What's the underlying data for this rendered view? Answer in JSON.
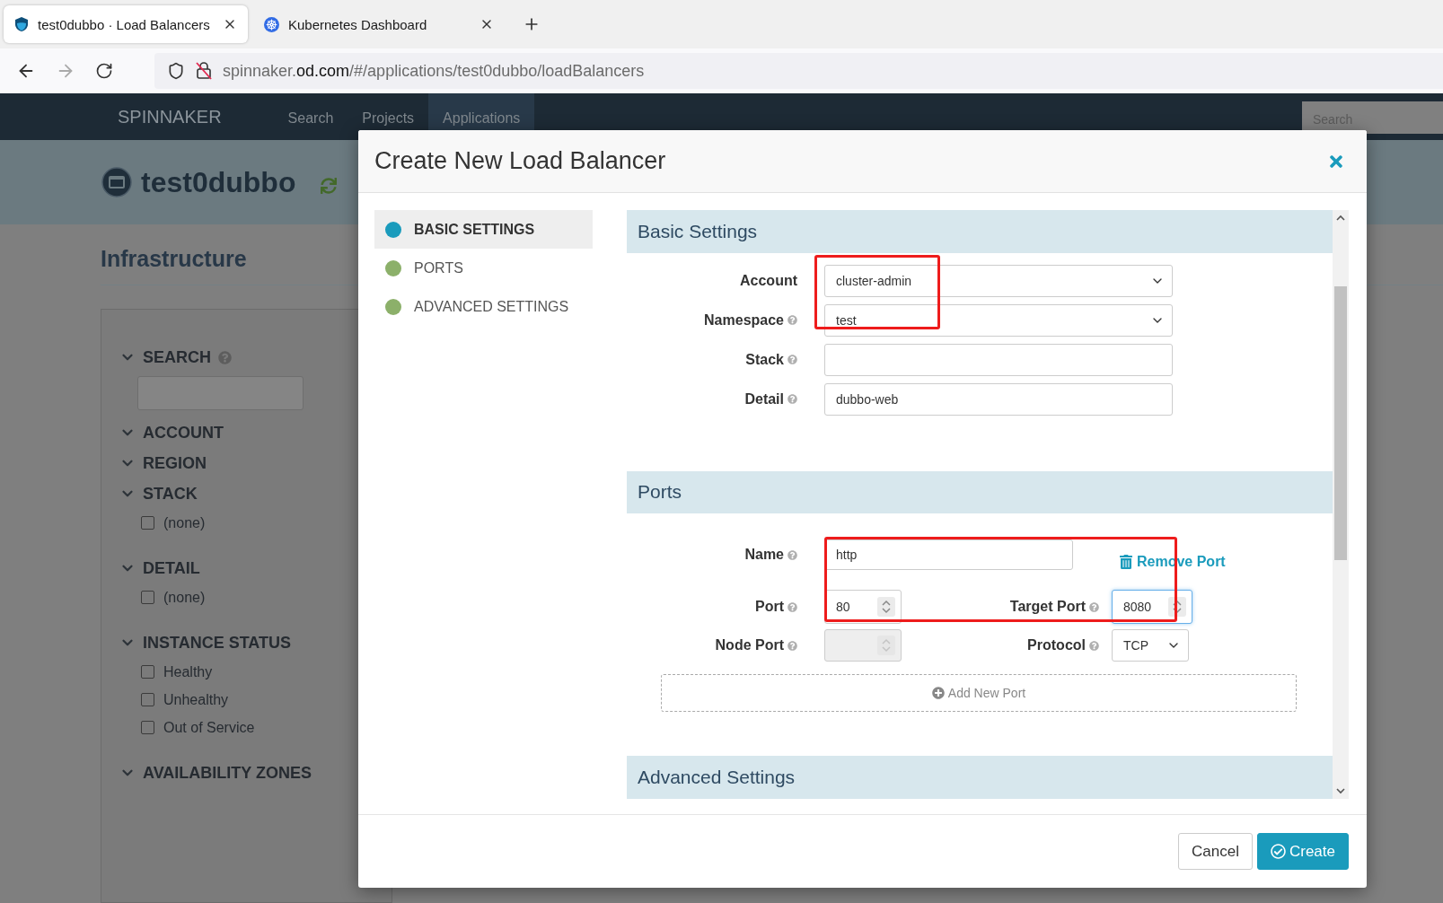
{
  "browser": {
    "tabs": [
      {
        "title": "test0dubbo · Load Balancers",
        "selected": true
      },
      {
        "title": "Kubernetes Dashboard",
        "selected": false
      }
    ],
    "url": {
      "prefix": "spinnaker.",
      "domain": "od.com",
      "path": "/#/applications/test0dubbo/loadBalancers"
    }
  },
  "navbar": {
    "brand": "SPINNAKER",
    "items": [
      {
        "label": "Search",
        "selected": false
      },
      {
        "label": "Projects",
        "selected": false
      },
      {
        "label": "Applications",
        "selected": true
      }
    ],
    "search": {
      "placeholder": "Search"
    }
  },
  "application": {
    "name": "test0dubbo",
    "section": "Infrastructure",
    "filters": [
      {
        "kind": "search",
        "label": "SEARCH",
        "help": true,
        "expanded": true
      },
      {
        "kind": "group",
        "label": "ACCOUNT",
        "help": false,
        "expanded": true
      },
      {
        "kind": "group",
        "label": "REGION",
        "help": false,
        "expanded": true
      },
      {
        "kind": "group",
        "label": "STACK",
        "help": false,
        "expanded": true,
        "options": [
          {
            "label": "(none)",
            "checked": false
          }
        ]
      },
      {
        "kind": "group",
        "label": "DETAIL",
        "help": false,
        "expanded": true,
        "options": [
          {
            "label": "(none)",
            "checked": false
          }
        ]
      },
      {
        "kind": "group",
        "label": "INSTANCE STATUS",
        "help": false,
        "expanded": true,
        "options": [
          {
            "label": "Healthy",
            "checked": false
          },
          {
            "label": "Unhealthy",
            "checked": false
          },
          {
            "label": "Out of Service",
            "checked": false
          }
        ]
      },
      {
        "kind": "group",
        "label": "AVAILABILITY ZONES",
        "help": false,
        "expanded": true
      }
    ]
  },
  "modal": {
    "title": "Create New Load Balancer",
    "steps": [
      {
        "label": "BASIC SETTINGS",
        "selected": true,
        "color": "#1a9bbc"
      },
      {
        "label": "PORTS",
        "selected": false,
        "color": "#8cb06a"
      },
      {
        "label": "ADVANCED SETTINGS",
        "selected": false,
        "color": "#8cb06a"
      }
    ],
    "sections": [
      {
        "kind": "basic",
        "title": "Basic Settings",
        "fields": [
          {
            "label": "Account",
            "help": false,
            "kind": "select",
            "value": "cluster-admin"
          },
          {
            "label": "Namespace",
            "help": true,
            "kind": "select",
            "value": "test"
          },
          {
            "label": "Stack",
            "help": true,
            "kind": "text"
          },
          {
            "label": "Detail",
            "help": true,
            "kind": "text",
            "value": "dubbo-web"
          }
        ]
      },
      {
        "kind": "ports",
        "title": "Ports",
        "ports": [
          {
            "name": {
              "label": "Name",
              "value": "http"
            },
            "port": {
              "label": "Port",
              "value": "80",
              "focused": false,
              "disabled": false
            },
            "target_port": {
              "label": "Target Port",
              "value": "8080",
              "focused": true,
              "disabled": false
            },
            "node_port": {
              "label": "Node Port",
              "focused": false,
              "disabled": true
            },
            "protocol": {
              "label": "Protocol",
              "value": "TCP"
            }
          }
        ],
        "remove_label": "Remove Port",
        "add_label": "Add New Port"
      },
      {
        "kind": "advanced",
        "title": "Advanced Settings"
      }
    ],
    "buttons": [
      {
        "label": "Cancel",
        "kind": "default"
      },
      {
        "label": "Create",
        "kind": "primary"
      }
    ]
  }
}
